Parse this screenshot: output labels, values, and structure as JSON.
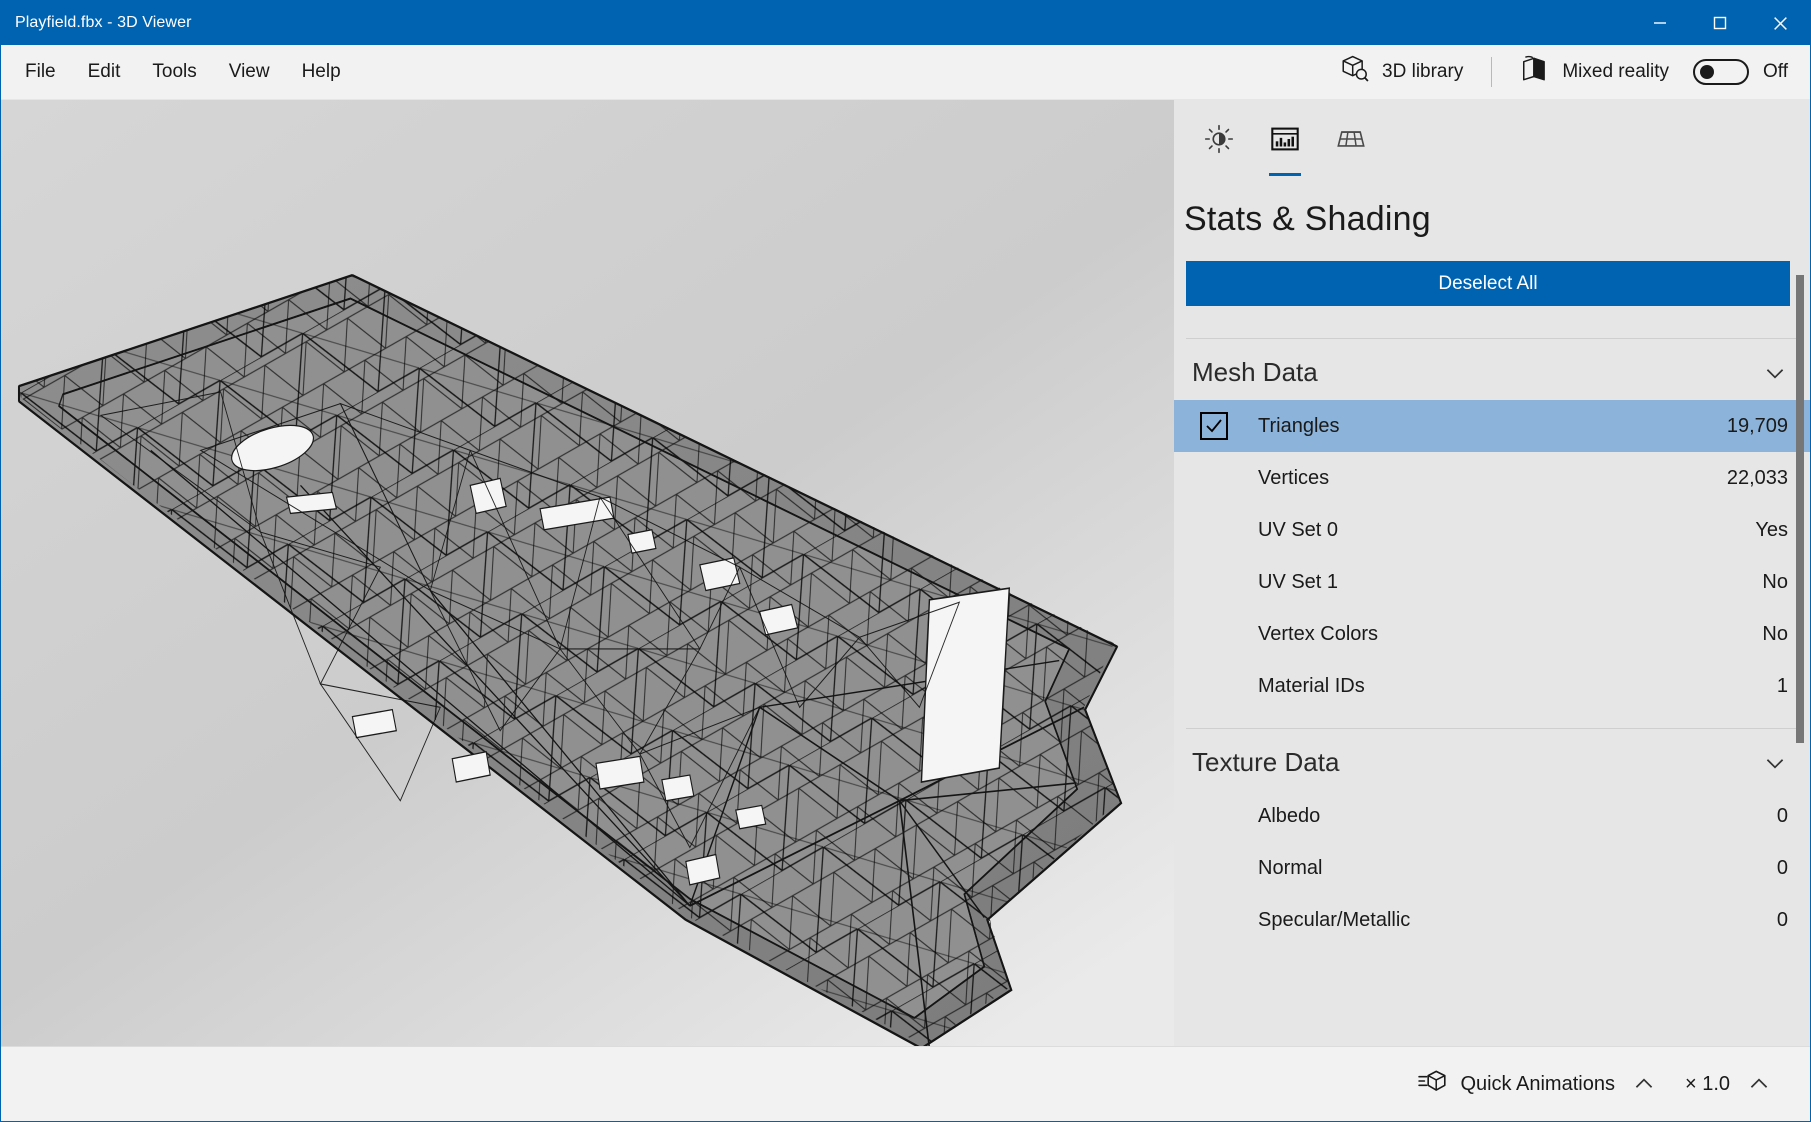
{
  "window": {
    "title": "Playfield.fbx - 3D Viewer",
    "accent_color": "#0063b1",
    "minimize_label": "Minimize",
    "maximize_label": "Maximize",
    "close_label": "Close"
  },
  "menubar": {
    "items": [
      {
        "label": "File"
      },
      {
        "label": "Edit"
      },
      {
        "label": "Tools"
      },
      {
        "label": "View"
      },
      {
        "label": "Help"
      }
    ],
    "library_label": "3D library",
    "mixed_reality_label": "Mixed reality",
    "mixed_reality_state": "Off"
  },
  "panel": {
    "tabs": [
      {
        "icon": "lighting-icon",
        "name": "lighting",
        "active": false
      },
      {
        "icon": "stats-icon",
        "name": "stats",
        "active": true
      },
      {
        "icon": "environment-grid-icon",
        "name": "environment",
        "active": false
      }
    ],
    "title": "Stats & Shading",
    "deselect_label": "Deselect All",
    "selected_color": "#8cb3d9",
    "sections": [
      {
        "title": "Mesh Data",
        "expanded": true,
        "rows": [
          {
            "label": "Triangles",
            "value": "19,709",
            "selected": true,
            "checked": true
          },
          {
            "label": "Vertices",
            "value": "22,033",
            "selected": false,
            "checked": false
          },
          {
            "label": "UV Set 0",
            "value": "Yes",
            "selected": false,
            "checked": false
          },
          {
            "label": "UV Set 1",
            "value": "No",
            "selected": false,
            "checked": false
          },
          {
            "label": "Vertex Colors",
            "value": "No",
            "selected": false,
            "checked": false
          },
          {
            "label": "Material IDs",
            "value": "1",
            "selected": false,
            "checked": false
          }
        ]
      },
      {
        "title": "Texture Data",
        "expanded": true,
        "rows": [
          {
            "label": "Albedo",
            "value": "0",
            "selected": false,
            "checked": false
          },
          {
            "label": "Normal",
            "value": "0",
            "selected": false,
            "checked": false
          },
          {
            "label": "Specular/Metallic",
            "value": "0",
            "selected": false,
            "checked": false
          }
        ]
      }
    ]
  },
  "statusbar": {
    "quick_animations_label": "Quick Animations",
    "speed_label": "× 1.0"
  },
  "viewport": {
    "model_name": "Playfield",
    "shading": "wireframe-shaded",
    "background": "#d2d2d2"
  }
}
